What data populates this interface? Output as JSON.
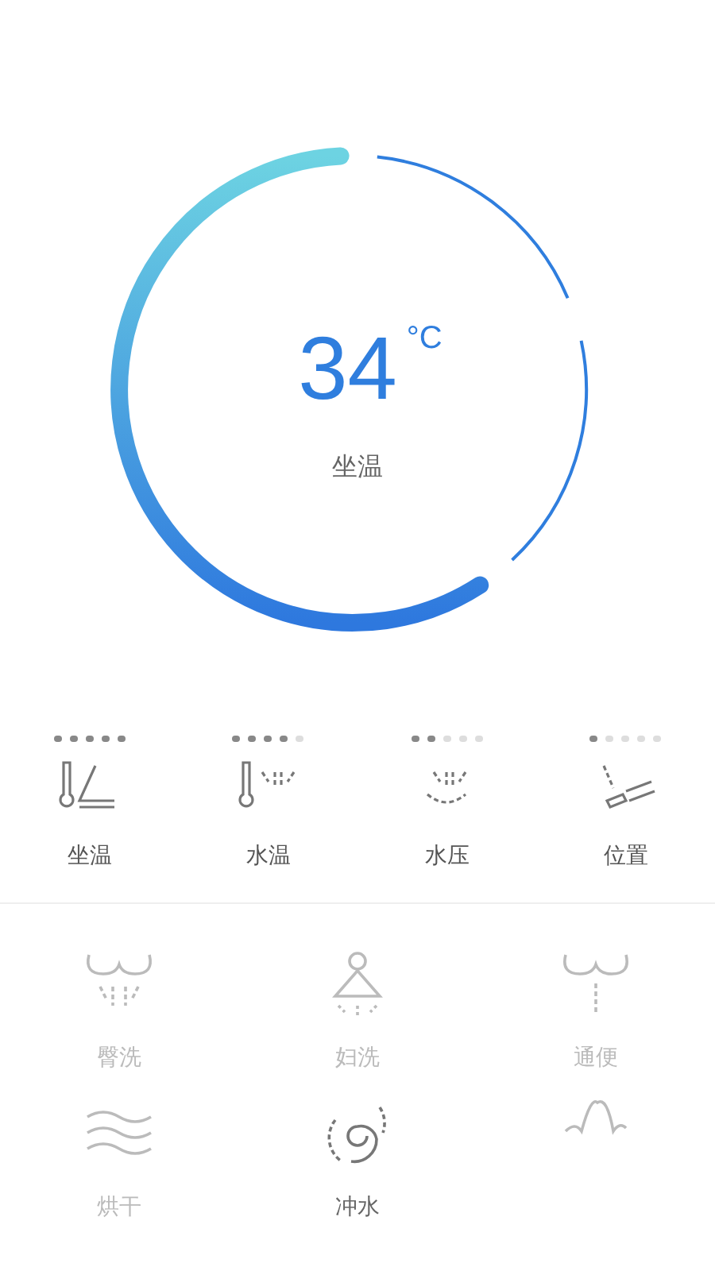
{
  "gauge": {
    "value": "34",
    "unit": "°C",
    "label": "坐温"
  },
  "settings": [
    {
      "kind": "seat",
      "label": "坐温",
      "stars": 5
    },
    {
      "kind": "water",
      "label": "水温",
      "stars": 4
    },
    {
      "kind": "pressure",
      "label": "水压",
      "stars": 2
    },
    {
      "kind": "position",
      "label": "位置",
      "stars": 1
    }
  ],
  "functions": [
    {
      "kind": "rear",
      "label": "臀洗",
      "disabled": true
    },
    {
      "kind": "front",
      "label": "妇洗",
      "disabled": true
    },
    {
      "kind": "stool",
      "label": "通便",
      "disabled": true
    },
    {
      "kind": "dry",
      "label": "烘干",
      "disabled": true
    },
    {
      "kind": "flush",
      "label": "冲水",
      "disabled": false
    },
    {
      "kind": "massage",
      "disabled": true
    }
  ]
}
